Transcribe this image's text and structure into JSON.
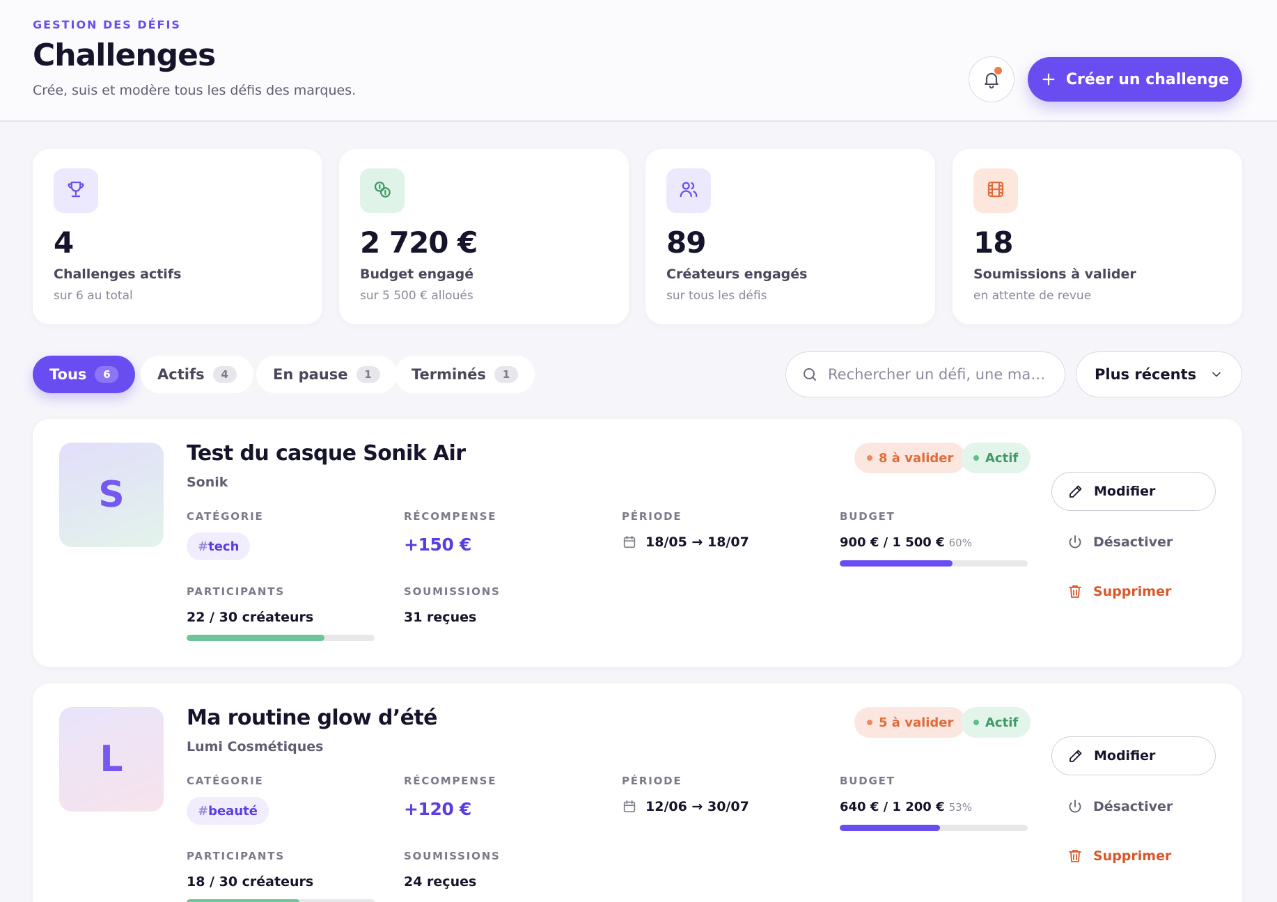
{
  "header": {
    "eyebrow": "GESTION DES DÉFIS",
    "title": "Challenges",
    "subtitle": "Crée, suis et modère tous les défis des marques.",
    "create_label": "Créer un challenge",
    "notification_unread": true,
    "accent_color": "#6a4df0"
  },
  "stats": [
    {
      "icon": "trophy-icon",
      "value": "4",
      "label": "Challenges actifs",
      "sub": "sur 6 au total",
      "icon_bg": "#ece8fd",
      "icon_color": "#6a4df0"
    },
    {
      "icon": "coins-icon",
      "value": "2 720 €",
      "label": "Budget engagé",
      "sub": "sur 5 500 € alloués",
      "icon_bg": "#e0f3e8",
      "icon_color": "#3f9a66"
    },
    {
      "icon": "users-icon",
      "value": "89",
      "label": "Créateurs engagés",
      "sub": "sur tous les défis",
      "icon_bg": "#ece8fd",
      "icon_color": "#6a4df0"
    },
    {
      "icon": "film-icon",
      "value": "18",
      "label": "Soumissions à valider",
      "sub": "en attente de revue",
      "icon_bg": "#fde6dc",
      "icon_color": "#e06c3b"
    }
  ],
  "filters": {
    "tabs": [
      {
        "label": "Tous",
        "count": "6",
        "active": true
      },
      {
        "label": "Actifs",
        "count": "4",
        "active": false
      },
      {
        "label": "En pause",
        "count": "1",
        "active": false
      },
      {
        "label": "Terminés",
        "count": "1",
        "active": false
      }
    ],
    "search_placeholder": "Rechercher un défi, une marque…",
    "sort_value": "Plus récents"
  },
  "labels": {
    "category": "CATÉGORIE",
    "reward": "RÉCOMPENSE",
    "period": "PÉRIODE",
    "budget": "BUDGET",
    "participants": "PARTICIPANTS",
    "submissions": "SOUMISSIONS",
    "edit": "Modifier",
    "deactivate": "Désactiver",
    "delete": "Supprimer"
  },
  "challenges": [
    {
      "initial": "S",
      "title": "Test du casque Sonik Air",
      "brand": "Sonik",
      "pending": "8 à valider",
      "status": "Actif",
      "category": "tech",
      "reward": "+150 €",
      "period": "18/05 → 18/07",
      "budget": "900 € / 1 500 €",
      "budget_pct": "60%",
      "budget_fraction": 0.6,
      "participants": "22 / 30 créateurs",
      "participants_fraction": 0.733,
      "submissions": "31 reçues",
      "avatar_gradient": [
        "#e2defb",
        "#e3f3ea"
      ]
    },
    {
      "initial": "L",
      "title": "Ma routine glow d’été",
      "brand": "Lumi Cosmétiques",
      "pending": "5 à valider",
      "status": "Actif",
      "category": "beauté",
      "reward": "+120 €",
      "period": "12/06 → 30/07",
      "budget": "640 € / 1 200 €",
      "budget_pct": "53%",
      "budget_fraction": 0.533,
      "participants": "18 / 30 créateurs",
      "participants_fraction": 0.6,
      "submissions": "24 reçues",
      "avatar_gradient": [
        "#e9e4fb",
        "#f7e3ec"
      ]
    }
  ]
}
